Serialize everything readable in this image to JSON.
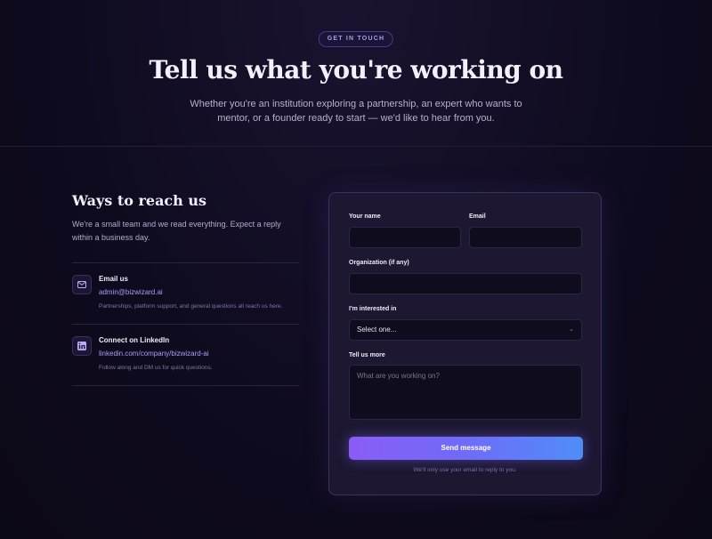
{
  "hero": {
    "eyebrow": "GET IN TOUCH",
    "title": "Tell us what you're working on",
    "subtitle": "Whether you're an institution exploring a partnership, an expert who wants to mentor, or a founder ready to start — we'd like to hear from you."
  },
  "reach": {
    "title": "Ways to reach us",
    "description": "We're a small team and we read everything. Expect a reply within a business day.",
    "items": [
      {
        "icon": "mail-icon",
        "title": "Email us",
        "link": "admin@bizwizard.ai",
        "note": "Partnerships, platform support, and general questions all reach us here."
      },
      {
        "icon": "linkedin-icon",
        "title": "Connect on LinkedIn",
        "link": "linkedin.com/company/bizwizard-ai",
        "note": "Follow along and DM us for quick questions."
      }
    ]
  },
  "form": {
    "name_label": "Your name",
    "name_value": "",
    "email_label": "Email",
    "email_value": "",
    "org_label": "Organization (if any)",
    "org_value": "",
    "interest_label": "I'm interested in",
    "interest_selected": "Select one...",
    "message_label": "Tell us more",
    "message_placeholder": "What are you working on?",
    "submit_label": "Send message",
    "fine_print": "We'll only use your email to reply to you."
  },
  "colors": {
    "accent": "#a99cf0",
    "button_gradient_start": "#8a5cf6",
    "button_gradient_end": "#4f8df8",
    "background": "#0d0a1a"
  }
}
